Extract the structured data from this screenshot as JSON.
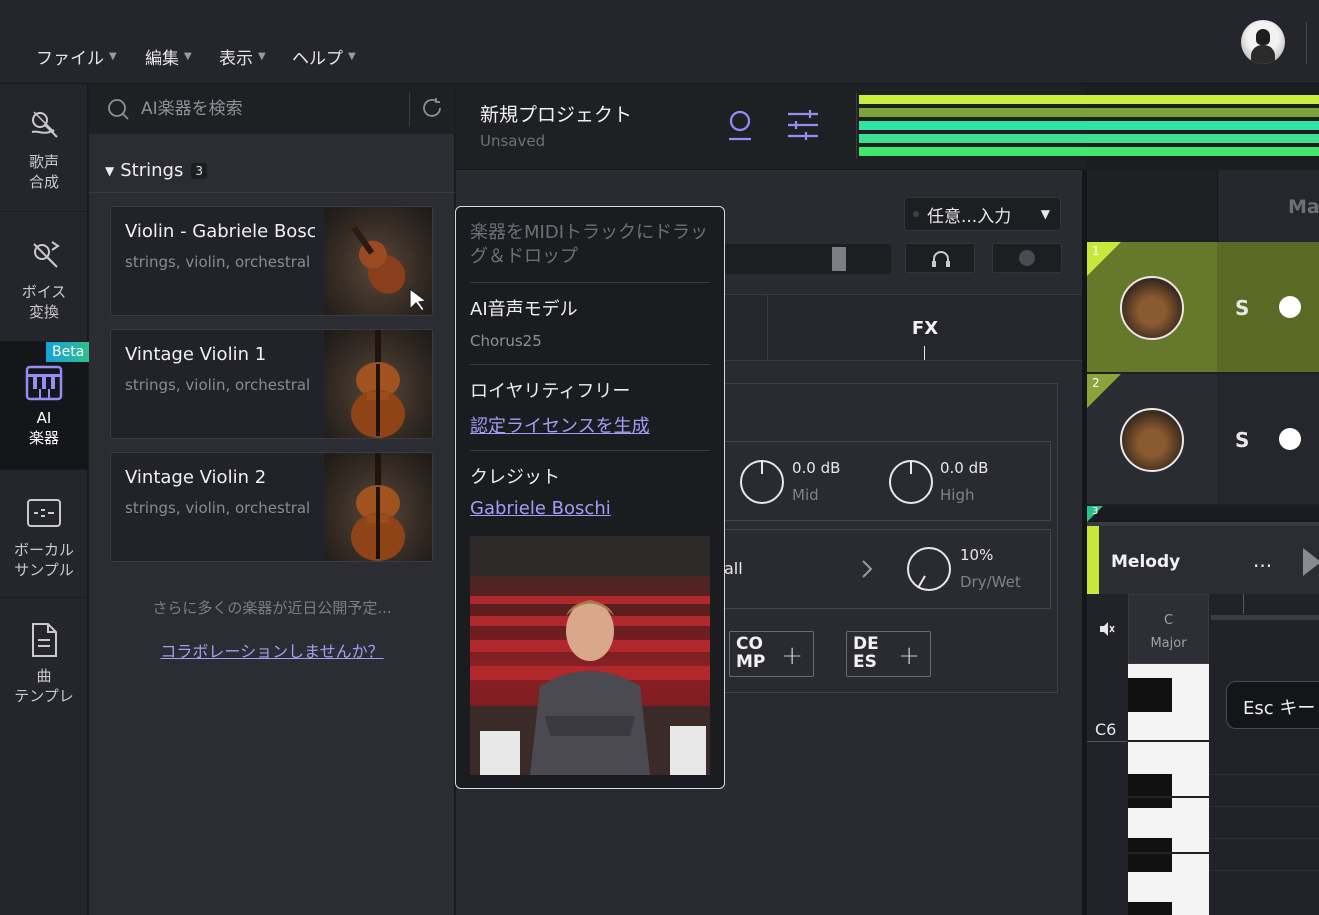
{
  "menu": {
    "items": [
      {
        "label": "ファイル"
      },
      {
        "label": "編集"
      },
      {
        "label": "表示"
      },
      {
        "label": "ヘルプ"
      }
    ]
  },
  "nav": {
    "items": [
      {
        "label": "歌声\n合成",
        "icon": "mic-icon"
      },
      {
        "label": "ボイス\n変換",
        "icon": "voice-convert-icon"
      },
      {
        "label": "AI\n楽器",
        "icon": "piano-icon",
        "badge": "Beta",
        "active": true
      },
      {
        "label": "ボーカル\nサンプル",
        "icon": "waveform-icon"
      },
      {
        "label": "曲\nテンプレ",
        "icon": "document-icon"
      }
    ]
  },
  "search": {
    "placeholder": "AI楽器を検索"
  },
  "group": {
    "name": "Strings",
    "count": "3"
  },
  "instruments": [
    {
      "name": "Violin - Gabriele Boschi",
      "tags": "strings, violin, orchestral"
    },
    {
      "name": "Vintage Violin 1",
      "tags": "strings, violin, orchestral"
    },
    {
      "name": "Vintage Violin 2",
      "tags": "strings, violin, orchestral"
    }
  ],
  "more_text": "さらに多くの楽器が近日公開予定...",
  "collab_link": "コラボレーションしませんか？",
  "project": {
    "title": "新規プロジェクト",
    "status": "Unsaved"
  },
  "meter_colors": [
    "#c7f03c",
    "#7aa33a",
    "#2fe3a3",
    "#3ee08f",
    "#3ee86b"
  ],
  "track_panel": {
    "input_select": "任意...入力",
    "tab_fx": "FX",
    "eq": [
      {
        "value": "0.0 dB",
        "label": "Mid"
      },
      {
        "value": "0.0 dB",
        "label": "High"
      }
    ],
    "reverb": {
      "name": "all",
      "value": "10%",
      "label": "Dry/Wet"
    },
    "fx_buttons": [
      {
        "label": "CO\nMP"
      },
      {
        "label": "DE\nES"
      }
    ]
  },
  "master_label": "Mas",
  "tracks": [
    {
      "number": "1",
      "solo": "S",
      "color": "#c7e83b"
    },
    {
      "number": "2",
      "solo": "S",
      "color": "#8aa33a"
    },
    {
      "number": "3",
      "color": "#2ec08a"
    }
  ],
  "melody": {
    "name": "Melody",
    "menu": "...",
    "key_top": "C",
    "key_bottom": "Major",
    "note_label": "C6",
    "esc_tip": "Esc キー"
  },
  "popover": {
    "hint": "楽器をMIDIトラックにドラッグ＆ドロップ",
    "model_title": "AI音声モデル",
    "model_value": "Chorus25",
    "royalty_title": "ロイヤリティフリー",
    "royalty_link": "認定ライセンスを生成",
    "credit_title": "クレジット",
    "credit_link": "Gabriele Boschi"
  }
}
